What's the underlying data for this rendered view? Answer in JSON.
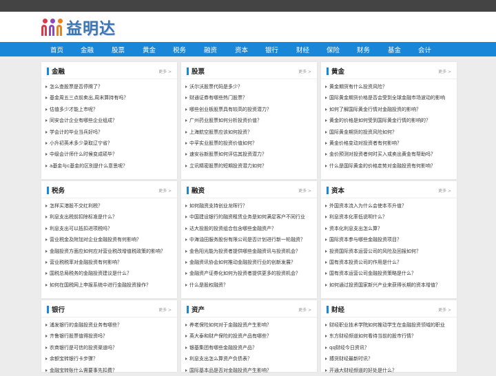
{
  "header": {
    "logo_text": "益明达"
  },
  "colors": {
    "nav_bg": "#1a86d8",
    "accent": "#1a86d8",
    "logo_orange": "#e8821e",
    "logo_red": "#d83a4c",
    "logo_purple": "#8b4ab8"
  },
  "nav": [
    "首页",
    "金融",
    "股票",
    "黄金",
    "税务",
    "融资",
    "资本",
    "银行",
    "财经",
    "保险",
    "财务",
    "基金",
    "会计"
  ],
  "more_label": "更多 >",
  "cards": [
    {
      "title": "金融",
      "items": [
        "怎么查股票是否停牌了？",
        "基金周五三点前卖出,周末算持有吗？",
        "估值多少才能上市呢？",
        "同安会计企业有哪些企业组成？",
        "学会计的毕业当兵好吗？",
        "小升初英术多少录取辽宁省？",
        "中级会计师什么时候变成硕毕？",
        "a基金与c基金的区别是什么意思呢？"
      ]
    },
    {
      "title": "股票",
      "items": [
        "沃尔沃股票代码是多少？",
        "财通证券有哪些热门股票？",
        "哪些创业板股票具有较高的投资潜力？",
        "广州药业股票如何分析投资价值？",
        "上海航空股票应该如何投资？",
        "中孚实业股票的投资价值如何？",
        "速安谷新股票如何评估其投资潜力？",
        "立讯精密股票的短期投资潜力如何？"
      ]
    },
    {
      "title": "黄金",
      "items": [
        "黄金期货有什么投资风险？",
        "国际黄金期货价格是否会受到全球金融市场波动的影响",
        "如何了解国际黄金行情对金融投资的影响？",
        "黄金的价格是如何受到国际黄金行情的影响的？",
        "国际黄金期货的投资风险如何？",
        "黄金价格变动对投资者有何影响？",
        "金价预测对投资者何时买入或卖出黄金有帮助吗？",
        "什么是国际黄金的价格走势对金融投资有何影响？"
      ]
    },
    {
      "title": "税务",
      "items": [
        "怎样买港股不交红利税？",
        "利息支出税前扣除标准是什么？",
        "利息支出可以抵扣进项税吗？",
        "营业税金及附加对企业金融投资有何影响？",
        "金融投资方面应如何应对营业税改增值税政策的影响？",
        "营业税税率对金融投资有何影响？",
        "国税总局税务的金融投资建议是什么？",
        "如何在国税网上申报系统中进行金融投资操作？"
      ]
    },
    {
      "title": "融资",
      "items": [
        "如何融资支持创业龙晖行？",
        "中国建设银行的融资租赁业务是如何满足客户不同行业",
        "达大投股的投资组合包含哪些金融资产？",
        "中海油田服务股份有限公司是否计划进行新一轮融资？",
        "金色阳光能为投资者提供哪些金融资讯与投资机会？",
        "金融资讯协会如何推动金融投资行业的创新发展？",
        "金融资产证券化如何为投资者提供更多的投资机会？",
        "什么是股权融资？"
      ]
    },
    {
      "title": "资本",
      "items": [
        "外国资本流入为什么会使本币升值？",
        "利息资本化率低说明什么？",
        "资本化利息支出怎么算？",
        "国际资本参与哪些金融投资项目？",
        "投资国际资本运营公司的风险及回报如何？",
        "国有资本投资公司的作用是什么？",
        "国有资本运营公司金融投资策略是什么？",
        "如何通过投资国家新兴产业来获得长期的资本增值？"
      ]
    },
    {
      "title": "银行",
      "items": [
        "浦发银行的金融投资业务有哪些？",
        "齐鲁银行股票值得投资吗？",
        "农商银行是可信的投资渠道吗？",
        "余额宝转银行卡步骤？",
        "金融宝转账什么需要事先扣费？"
      ]
    },
    {
      "title": "资产",
      "items": [
        "养老保险如何对于金融投资产生影响？",
        "英大泰和财产保险的投资产品有哪些？",
        "银基集团有哪些金融投资产品？",
        "利息支出怎么算资产负债表？",
        "国际基本品是否对金融投资产生影响？"
      ]
    },
    {
      "title": "财经",
      "items": [
        "财经职业技术学院如何推动学生在金融投资领域的职业",
        "东方财经频道如何看待当前的股市行情？",
        "qq财经今日资讯？",
        "搏货财经最新时讯？",
        "开通大财经频道的好处是什么？"
      ]
    }
  ]
}
